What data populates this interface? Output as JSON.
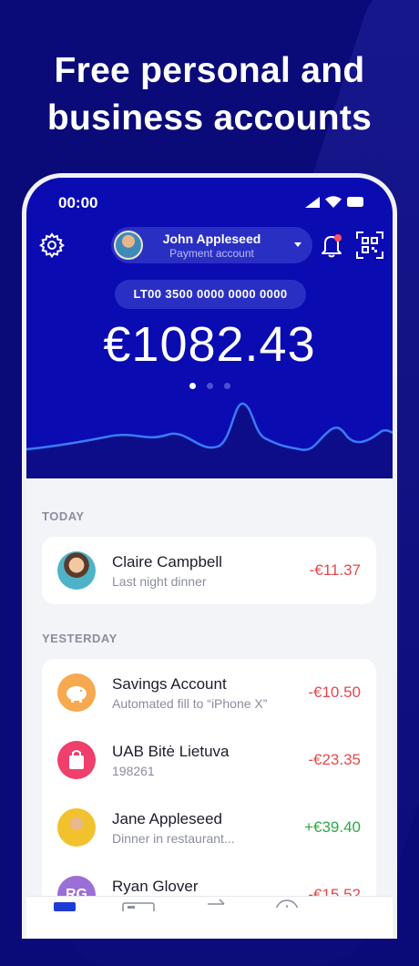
{
  "headline": {
    "line1": "Free personal and",
    "line2": "business accounts"
  },
  "status": {
    "time": "00:00"
  },
  "account": {
    "name": "John Appleseed",
    "type": "Payment account"
  },
  "iban": "LT00 3500 0000 0000 0000",
  "balance": "€1082.43",
  "pager": {
    "count": 3,
    "active": 1
  },
  "sections": {
    "today": "TODAY",
    "yesterday": "YESTERDAY"
  },
  "transactions_today": [
    {
      "name": "Claire Campbell",
      "desc": "Last night dinner",
      "amount": "-€11.37",
      "sign": "negative",
      "icon": "person-photo"
    }
  ],
  "transactions_yesterday": [
    {
      "name": "Savings Account",
      "desc": "Automated fill to “iPhone X”",
      "amount": "-€10.50",
      "sign": "negative",
      "icon": "piggy-bank-icon",
      "color": "#f6a94f"
    },
    {
      "name": "UAB Bitė Lietuva",
      "desc": "198261",
      "amount": "-€23.35",
      "sign": "negative",
      "icon": "shopping-bag-icon",
      "color": "#ef3f6a"
    },
    {
      "name": "Jane Appleseed",
      "desc": "Dinner in restaurant...",
      "amount": "+€39.40",
      "sign": "positive",
      "icon": "person-photo",
      "color": "#f2c12e"
    },
    {
      "name": "Ryan Glover",
      "desc": "",
      "amount": "-€15.52",
      "sign": "negative",
      "icon": "initials-avatar",
      "initials": "RG",
      "color": "#9b6fd6"
    }
  ],
  "colors": {
    "background": "#0a0a78",
    "header": "#0b0bb2",
    "negative": "#e5484d",
    "positive": "#2ea84a"
  }
}
